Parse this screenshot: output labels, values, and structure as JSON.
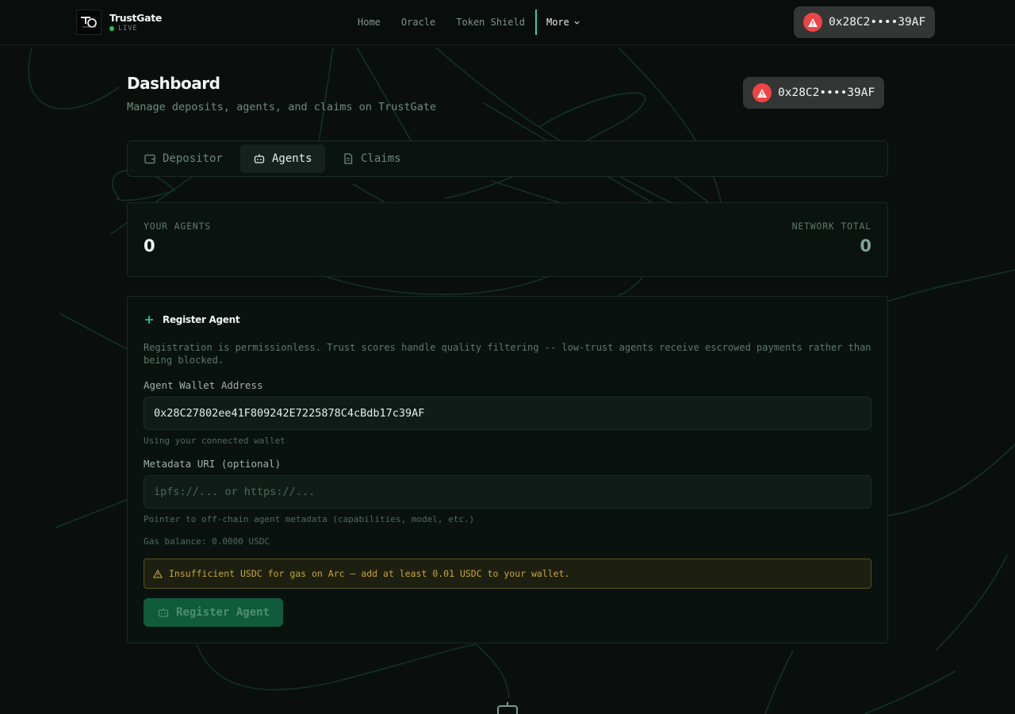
{
  "brand": {
    "name": "TrustGate",
    "status": "LIVE"
  },
  "nav": {
    "links": [
      "Home",
      "Oracle",
      "Token Shield"
    ],
    "more_label": "More"
  },
  "wallet": {
    "address_short": "0x28C2••••39AF"
  },
  "page": {
    "title": "Dashboard",
    "subtitle": "Manage deposits, agents, and claims on TrustGate"
  },
  "tabs": [
    {
      "label": "Depositor",
      "icon": "wallet-icon"
    },
    {
      "label": "Agents",
      "icon": "bot-icon",
      "active": true
    },
    {
      "label": "Claims",
      "icon": "document-icon"
    }
  ],
  "stats": {
    "your_agents_label": "YOUR AGENTS",
    "your_agents_value": "0",
    "network_total_label": "NETWORK TOTAL",
    "network_total_value": "0"
  },
  "register": {
    "title": "Register Agent",
    "description": "Registration is permissionless. Trust scores handle quality filtering -- low-trust agents receive escrowed payments rather than being blocked.",
    "wallet_label": "Agent Wallet Address",
    "wallet_value": "0x28C27802ee41F809242E7225878C4cBdb17c39AF",
    "wallet_hint": "Using your connected wallet",
    "metadata_label": "Metadata URI (optional)",
    "metadata_placeholder": "ipfs://... or https://...",
    "metadata_hint": "Pointer to off-chain agent metadata (capabilities, model, etc.)",
    "gas_balance": "Gas balance: 0.0000 USDC",
    "warning": "Insufficient USDC for gas on Arc — add at least 0.01 USDC to your wallet.",
    "button_label": "Register Agent"
  },
  "colors": {
    "accent": "#2dd4a0",
    "background": "#0a0f0d",
    "warning": "#c9a53a",
    "danger": "#ef4444",
    "button": "#0f5b3c"
  }
}
